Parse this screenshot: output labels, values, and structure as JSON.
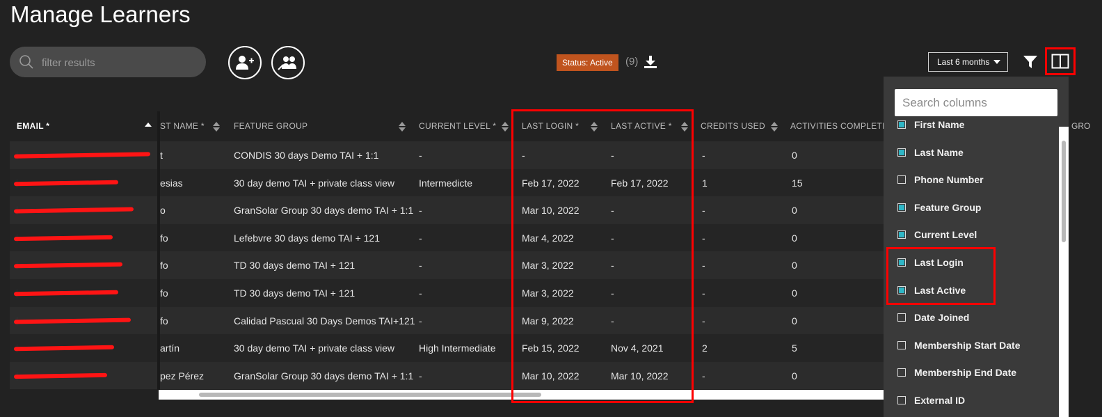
{
  "page": {
    "title": "Manage Learners"
  },
  "search": {
    "placeholder": "filter results"
  },
  "status": {
    "badge": "Status: Active",
    "count": "(9)"
  },
  "period": {
    "selected": "Last 6 months"
  },
  "icons": {
    "search": "search-icon",
    "add_learner": "add-user-icon",
    "manage_groups": "users-group-icon",
    "download": "download-icon",
    "dropdown": "chevron-down-icon",
    "filter": "filter-icon",
    "columns": "columns-icon",
    "sort": "sort-icon"
  },
  "colors": {
    "background": "#222222",
    "badge": "#c0541e",
    "link": "#4aa3d8",
    "checkbox": "#2fb6c6",
    "highlight": "#ff0000"
  },
  "table": {
    "headers": {
      "email": "EMAIL *",
      "last_name": "ST NAME *",
      "feature_group": "FEATURE GROUP",
      "current_level": "CURRENT LEVEL *",
      "last_login": "LAST LOGIN *",
      "last_active": "LAST ACTIVE *",
      "credits_used": "CREDITS USED",
      "activities_completed": "ACTIVITIES COMPLETE",
      "next": "GRO"
    },
    "rows": [
      {
        "email": "[redacted]",
        "last_name": "t",
        "feature_group": "CONDIS 30 days Demo TAI + 1:1",
        "current_level": "-",
        "last_login": "-",
        "last_active": "-",
        "credits_used": "-",
        "activities_completed": "0"
      },
      {
        "email": "[redacted]",
        "last_name": "esias",
        "feature_group": "30 day demo TAI + private class view",
        "current_level": "Intermedicte",
        "last_login": "Feb 17, 2022",
        "last_active": "Feb 17, 2022",
        "credits_used": "1",
        "activities_completed": "15"
      },
      {
        "email": "[redacted]",
        "last_name": "o",
        "feature_group": "GranSolar Group 30 days demo TAI + 1:1",
        "current_level": "-",
        "last_login": "Mar 10, 2022",
        "last_active": "-",
        "credits_used": "-",
        "activities_completed": "0"
      },
      {
        "email": "[redacted]",
        "last_name": "fo",
        "feature_group": "Lefebvre 30 days demo TAI + 121",
        "current_level": "-",
        "last_login": "Mar 4, 2022",
        "last_active": "-",
        "credits_used": "-",
        "activities_completed": "0"
      },
      {
        "email": "[redacted]",
        "last_name": "fo",
        "feature_group": "TD 30 days demo TAI + 121",
        "current_level": "-",
        "last_login": "Mar 3, 2022",
        "last_active": "-",
        "credits_used": "-",
        "activities_completed": "0"
      },
      {
        "email": "[redacted]",
        "last_name": "fo",
        "feature_group": "TD 30 days demo TAI + 121",
        "current_level": "-",
        "last_login": "Mar 3, 2022",
        "last_active": "-",
        "credits_used": "-",
        "activities_completed": "0"
      },
      {
        "email": "[redacted]",
        "last_name": "fo",
        "feature_group": "Calidad Pascual 30 Days Demos TAI+121",
        "current_level": "-",
        "last_login": "Mar 9, 2022",
        "last_active": "-",
        "credits_used": "-",
        "activities_completed": "0"
      },
      {
        "email": "[redacted]",
        "last_name": "artín",
        "feature_group": "30 day demo TAI + private class view",
        "current_level": "High Intermediate",
        "last_login": "Feb 15, 2022",
        "last_active": "Nov 4, 2021",
        "credits_used": "2",
        "activities_completed": "5"
      },
      {
        "email": "[redacted]",
        "last_name": "pez Pérez",
        "feature_group": "GranSolar Group 30 days demo TAI + 1:1",
        "current_level": "-",
        "last_login": "Mar 10, 2022",
        "last_active": "Mar 10, 2022",
        "credits_used": "-",
        "activities_completed": "0"
      }
    ]
  },
  "columns_panel": {
    "search_placeholder": "Search columns",
    "options": [
      {
        "label": "First Name",
        "checked": true
      },
      {
        "label": "Last Name",
        "checked": true
      },
      {
        "label": "Phone Number",
        "checked": false
      },
      {
        "label": "Feature Group",
        "checked": true
      },
      {
        "label": "Current Level",
        "checked": true
      },
      {
        "label": "Last Login",
        "checked": true
      },
      {
        "label": "Last Active",
        "checked": true
      },
      {
        "label": "Date Joined",
        "checked": false
      },
      {
        "label": "Membership Start Date",
        "checked": false
      },
      {
        "label": "Membership End Date",
        "checked": false
      },
      {
        "label": "External ID",
        "checked": false
      }
    ]
  }
}
